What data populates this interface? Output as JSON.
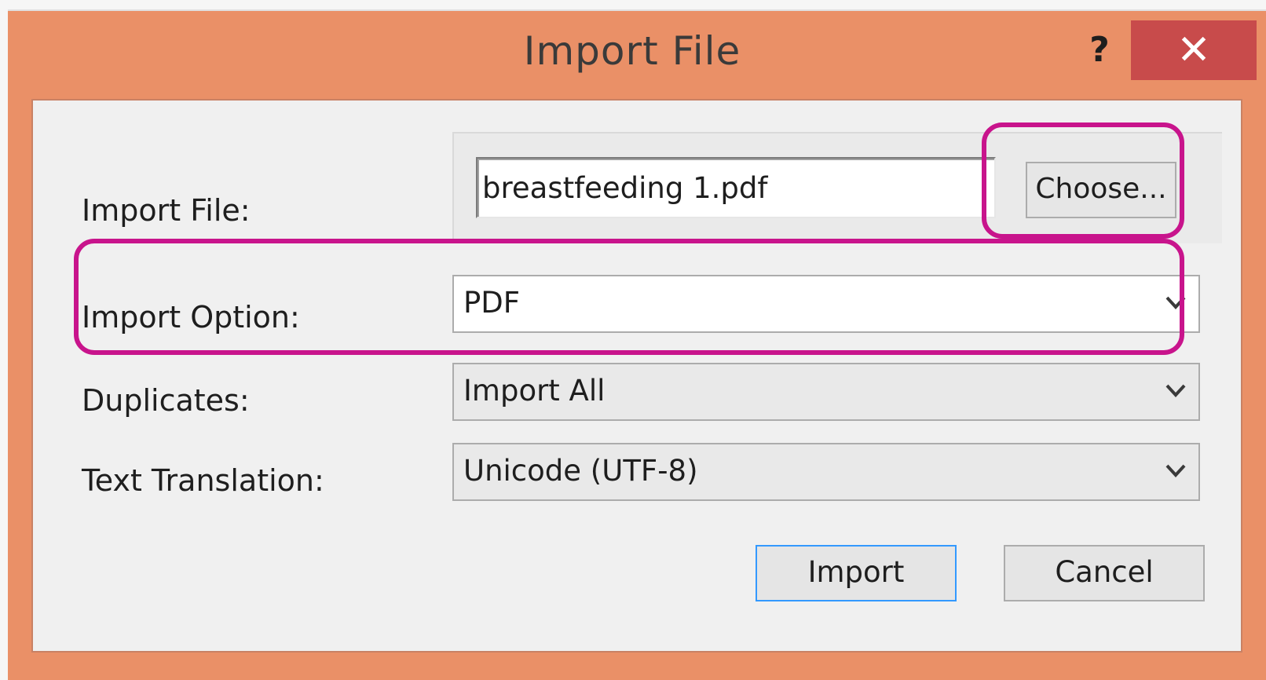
{
  "window": {
    "title": "Import File",
    "help_symbol": "?",
    "close_symbol": "✕"
  },
  "form": {
    "import_file_label": "Import File:",
    "import_file_value": "breastfeeding 1.pdf",
    "choose_label": "Choose...",
    "import_option_label": "Import Option:",
    "import_option_value": "PDF",
    "duplicates_label": "Duplicates:",
    "duplicates_value": "Import All",
    "text_translation_label": "Text Translation:",
    "text_translation_value": "Unicode (UTF-8)"
  },
  "buttons": {
    "import_label": "Import",
    "cancel_label": "Cancel"
  },
  "colors": {
    "title_bar": "#ea9067",
    "close_button": "#c84b4b",
    "highlight": "#c8148c",
    "default_button_border": "#3399ff"
  }
}
